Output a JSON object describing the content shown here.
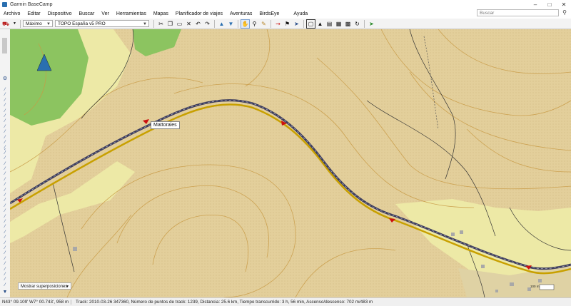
{
  "window": {
    "title": "Garmin BaseCamp"
  },
  "menu": [
    "Archivo",
    "Editar",
    "Dispositivo",
    "Buscar",
    "Ver",
    "Herramientas",
    "Mapas",
    "Planificador de viajes",
    "Aventuras",
    "BirdsEye",
    "Ayuda"
  ],
  "search": {
    "placeholder": "Buscar"
  },
  "toolbar": {
    "detail_label": "Máximo",
    "map_product": "TOPO España v5 PRO"
  },
  "map": {
    "waypoint_label": "Mattorales",
    "overlay_select": "Mostrar superposiciones",
    "scale_label": "100 m"
  },
  "status": {
    "coords": "N43° 09.109' W7° 00.743', 958 m",
    "track": "Track: 2010-03-26 347360, Número de puntos de track: 1239, Distancia: 25.6 km, Tiempo transcurrido: 3 h, 56 min, Ascenso/descenso: 702 m/483 m"
  },
  "colors": {
    "terrain": "#e3cf9b",
    "forest": "#8cc460",
    "lowland": "#ede9a6",
    "track": "#3d3d5c",
    "road": "#c8a000"
  }
}
